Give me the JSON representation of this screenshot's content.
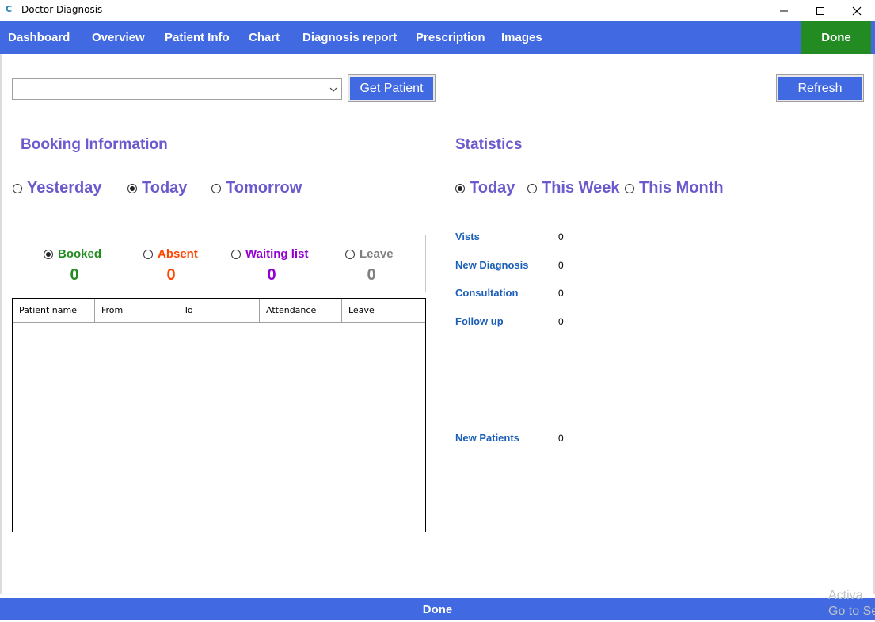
{
  "window": {
    "title": "Doctor Diagnosis",
    "icon_glyph": "C"
  },
  "nav": {
    "items": [
      "Dashboard",
      "Overview",
      "Patient Info",
      "Chart",
      "Diagnosis report",
      "Prescription",
      "Images"
    ],
    "done_label": "Done"
  },
  "patient_select": {
    "value": ""
  },
  "buttons": {
    "get_patient": "Get Patient",
    "refresh": "Refresh"
  },
  "booking": {
    "title": "Booking Information",
    "day_options": [
      {
        "label": "Yesterday",
        "checked": false
      },
      {
        "label": "Today",
        "checked": true
      },
      {
        "label": "Tomorrow",
        "checked": false
      }
    ],
    "attendance": [
      {
        "label": "Booked",
        "count": "0",
        "color": "#228b22",
        "checked": true
      },
      {
        "label": "Absent",
        "count": "0",
        "color": "#ff4500",
        "checked": false
      },
      {
        "label": "Waiting list",
        "count": "0",
        "color": "#9400d3",
        "checked": false
      },
      {
        "label": "Leave",
        "count": "0",
        "color": "#808080",
        "checked": false
      }
    ],
    "table_columns": [
      "Patient name",
      "From",
      "To",
      "Attendance",
      "Leave"
    ]
  },
  "statistics": {
    "title": "Statistics",
    "period_options": [
      {
        "label": "Today",
        "checked": true
      },
      {
        "label": "This Week",
        "checked": false
      },
      {
        "label": "This Month",
        "checked": false
      }
    ],
    "rows": [
      {
        "label": "Vists",
        "value": "0"
      },
      {
        "label": "New Diagnosis",
        "value": "0"
      },
      {
        "label": "Consultation",
        "value": "0"
      },
      {
        "label": "Follow up",
        "value": "0"
      },
      {
        "label": "New Patients",
        "value": "0"
      }
    ]
  },
  "footer": {
    "done_label": "Done"
  },
  "watermark": {
    "line1": "Activa",
    "line2": "Go to Se"
  },
  "colors": {
    "nav_blue": "#4169e1",
    "done_green": "#228b22",
    "heading_purple": "#6a5acd",
    "stat_blue": "#1b5fb8"
  }
}
